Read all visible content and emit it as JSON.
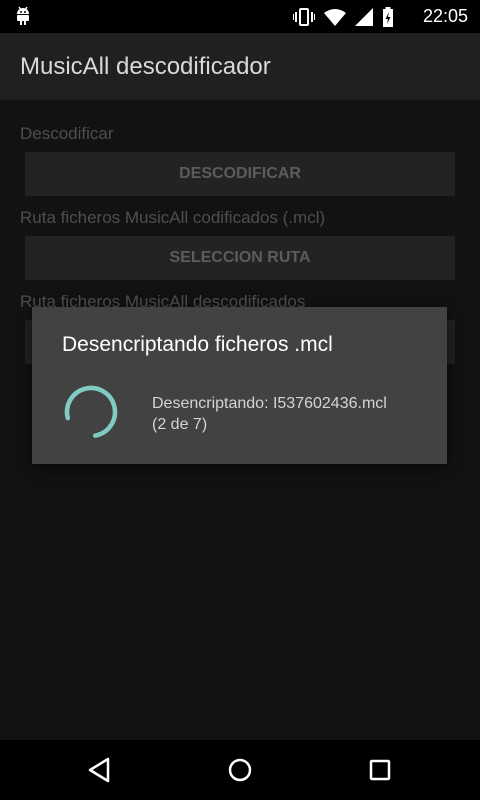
{
  "status_bar": {
    "time": "22:05",
    "icons": [
      "android-icon",
      "vibrate-icon",
      "wifi-icon",
      "signal-icon",
      "battery-icon"
    ]
  },
  "app_bar": {
    "title": "MusicAll descodificador"
  },
  "main": {
    "sections": [
      {
        "label": "Descodificar",
        "button_label": "DESCODIFICAR"
      },
      {
        "label": "Ruta ficheros MusicAll codificados (.mcl)",
        "button_label": "SELECCION RUTA"
      },
      {
        "label": "Ruta ficheros MusicAll descodificados",
        "button_label": ""
      }
    ]
  },
  "dialog": {
    "title": "Desencriptando ficheros .mcl",
    "message_line1": "Desencriptando: I537602436.mcl",
    "message_line2": "(2 de 7)",
    "spinner_color": "#80cbc4"
  },
  "nav_bar": {
    "icons": [
      "back-icon",
      "home-icon",
      "recents-icon"
    ]
  }
}
